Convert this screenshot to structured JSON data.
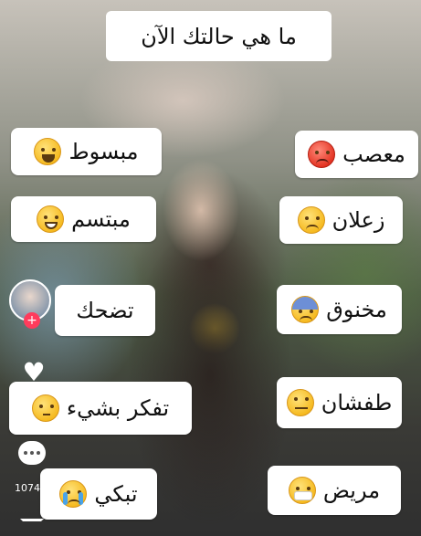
{
  "title": "ما هي حالتك الآن",
  "options_right": [
    {
      "label": "معصب",
      "icon": "angry-face-icon"
    },
    {
      "label": "زعلان",
      "icon": "upset-face-icon"
    },
    {
      "label": "مخنوق",
      "icon": "anxious-face-icon"
    },
    {
      "label": "طفشان",
      "icon": "eye-roll-face-icon"
    },
    {
      "label": "مريض",
      "icon": "medical-mask-face-icon"
    }
  ],
  "options_left": [
    {
      "label": "مبسوط",
      "icon": "laughing-face-icon"
    },
    {
      "label": "مبتسم",
      "icon": "grinning-face-icon"
    },
    {
      "label": "تضحك",
      "icon": "none"
    },
    {
      "label": "تفكر بشيء",
      "icon": "thinking-face-icon"
    },
    {
      "label": "تبكي",
      "icon": "crying-face-icon"
    }
  ],
  "side_bar": {
    "comment_count": "1074"
  }
}
